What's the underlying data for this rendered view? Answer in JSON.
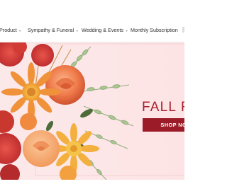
{
  "nav": {
    "items": [
      {
        "label": "Product",
        "chevron": "chevron-down"
      },
      {
        "label": "Sympathy & Funeral",
        "chevron": "chevron-down"
      },
      {
        "label": "Wedding & Events",
        "chevron": "chevron-down"
      },
      {
        "label": "Monthly Subscription"
      }
    ]
  },
  "hero": {
    "title": "FALL F",
    "button_label": "SHOP NOW",
    "colors": {
      "title": "#a8202b",
      "button": "#9b1c28",
      "background": "#fde6e7"
    }
  }
}
